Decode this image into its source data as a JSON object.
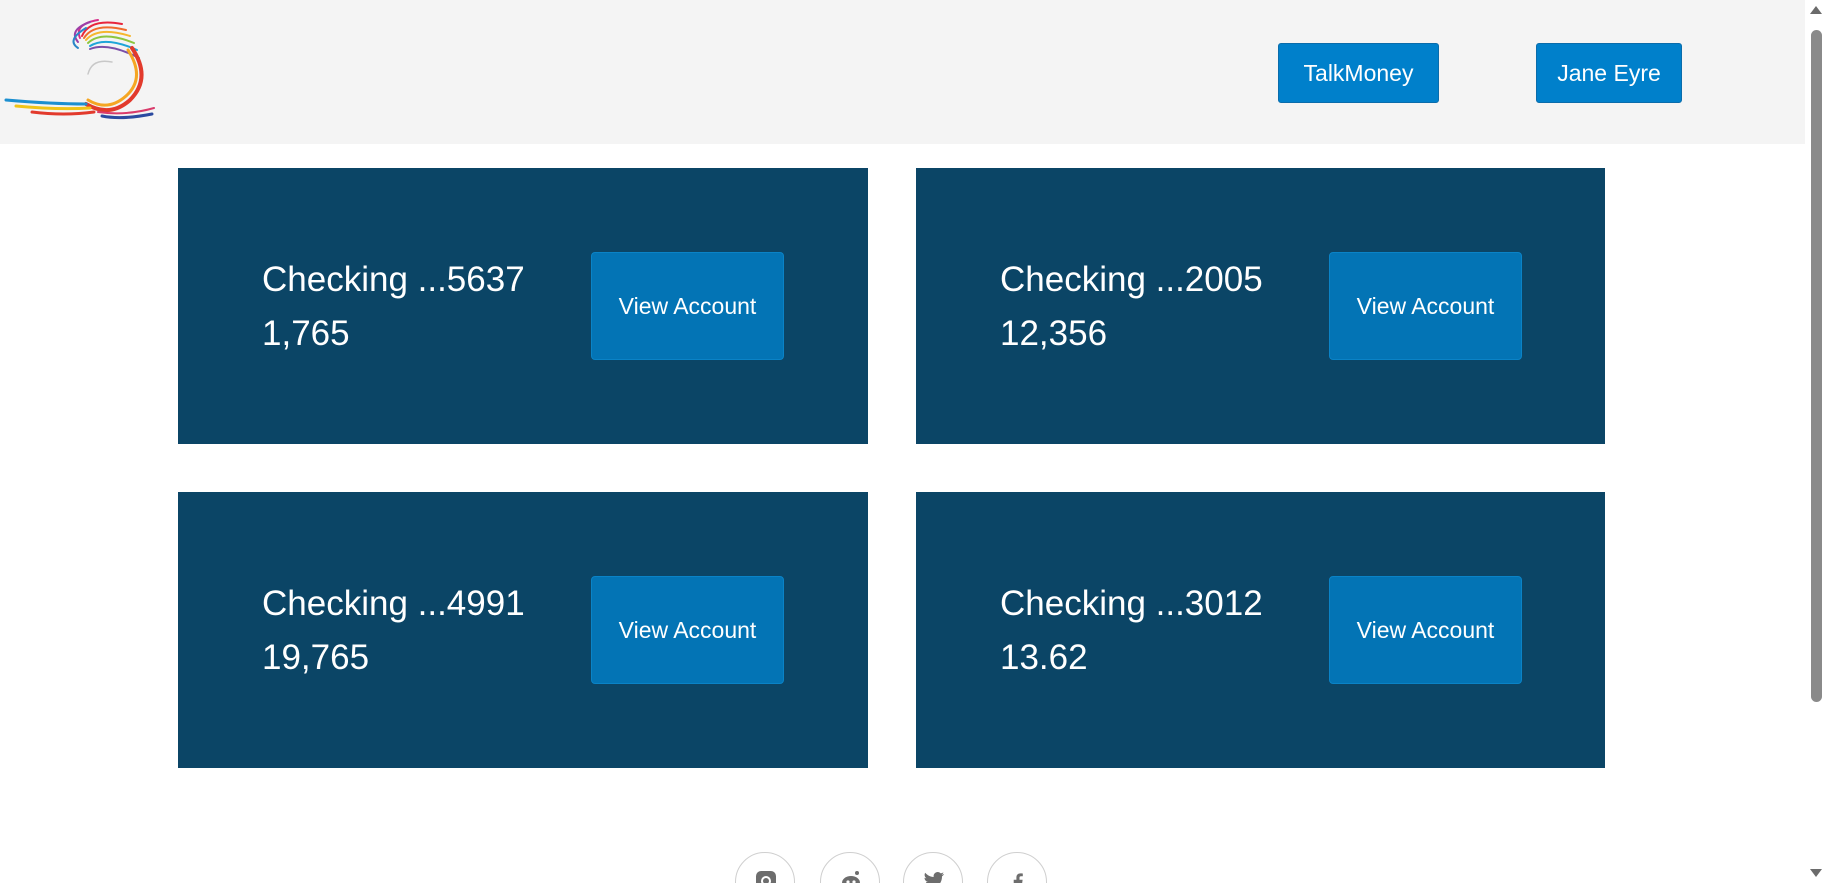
{
  "header": {
    "logo": "rainbow-swirl-logo",
    "talkmoney_label": "TalkMoney",
    "user_label": "Jane Eyre"
  },
  "accounts": [
    {
      "title": "Checking ...5637",
      "balance": "1,765",
      "button_label": "View Account"
    },
    {
      "title": "Checking ...2005",
      "balance": "12,356",
      "button_label": "View Account"
    },
    {
      "title": "Checking ...4991",
      "balance": "19,765",
      "button_label": "View Account"
    },
    {
      "title": "Checking ...3012",
      "balance": "13.62",
      "button_label": "View Account"
    }
  ],
  "footer": {
    "social_icons": [
      "instagram-icon",
      "reddit-icon",
      "twitter-icon",
      "facebook-icon"
    ]
  },
  "colors": {
    "header_bg": "#f4f4f4",
    "card_bg": "#0b4566",
    "button_bg": "#0374b5",
    "header_button_bg": "#0080cb"
  }
}
